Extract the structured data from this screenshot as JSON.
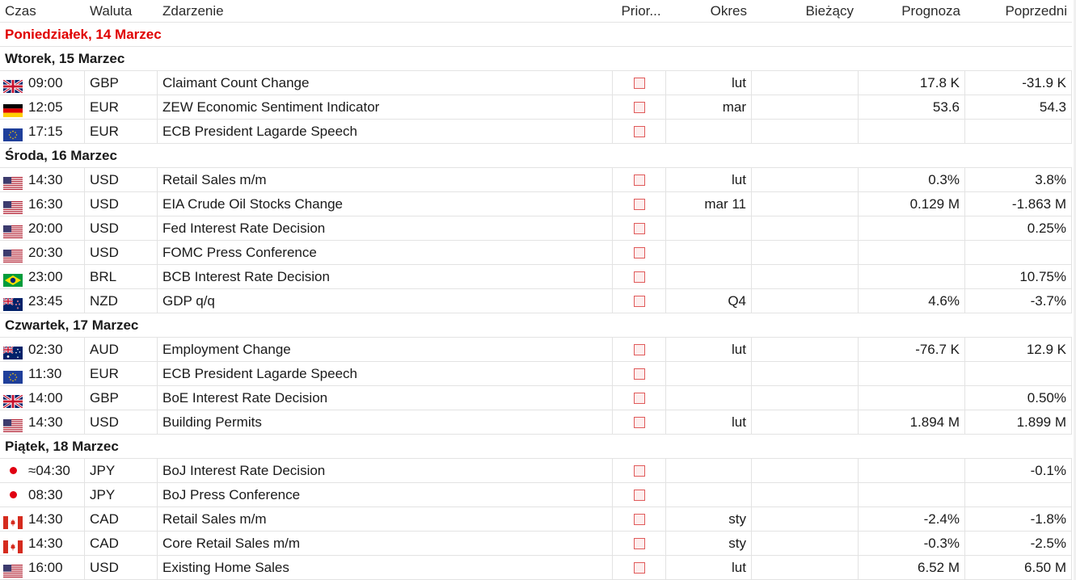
{
  "columns": {
    "time": "Czas",
    "currency": "Waluta",
    "event": "Zdarzenie",
    "priority": "Prior...",
    "period": "Okres",
    "actual": "Bieżący",
    "forecast": "Prognoza",
    "previous": "Poprzedni"
  },
  "colors": {
    "today_day": "#e00000",
    "priority_border": "#e05a5a",
    "priority_fill": "#fdeeee"
  },
  "sections": [
    {
      "day": "Poniedziałek, 14 Marzec",
      "today": true,
      "rows": []
    },
    {
      "day": "Wtorek, 15 Marzec",
      "rows": [
        {
          "flag": "gb-flag",
          "time": "09:00",
          "currency": "GBP",
          "event": "Claimant Count Change",
          "period": "lut",
          "actual": "",
          "forecast": "17.8 K",
          "previous": "-31.9 K"
        },
        {
          "flag": "de-flag",
          "time": "12:05",
          "currency": "EUR",
          "event": "ZEW Economic Sentiment Indicator",
          "period": "mar",
          "actual": "",
          "forecast": "53.6",
          "previous": "54.3"
        },
        {
          "flag": "eu-flag",
          "time": "17:15",
          "currency": "EUR",
          "event": "ECB President Lagarde Speech",
          "period": "",
          "actual": "",
          "forecast": "",
          "previous": ""
        }
      ]
    },
    {
      "day": "Środa, 16 Marzec",
      "rows": [
        {
          "flag": "us-flag",
          "time": "14:30",
          "currency": "USD",
          "event": "Retail Sales m/m",
          "period": "lut",
          "actual": "",
          "forecast": "0.3%",
          "previous": "3.8%"
        },
        {
          "flag": "us-flag",
          "time": "16:30",
          "currency": "USD",
          "event": "EIA Crude Oil Stocks Change",
          "period": "mar 11",
          "actual": "",
          "forecast": "0.129 M",
          "previous": "-1.863 M"
        },
        {
          "flag": "us-flag",
          "time": "20:00",
          "currency": "USD",
          "event": "Fed Interest Rate Decision",
          "period": "",
          "actual": "",
          "forecast": "",
          "previous": "0.25%"
        },
        {
          "flag": "us-flag",
          "time": "20:30",
          "currency": "USD",
          "event": "FOMC Press Conference",
          "period": "",
          "actual": "",
          "forecast": "",
          "previous": ""
        },
        {
          "flag": "br-flag",
          "time": "23:00",
          "currency": "BRL",
          "event": "BCB Interest Rate Decision",
          "period": "",
          "actual": "",
          "forecast": "",
          "previous": "10.75%"
        },
        {
          "flag": "nz-flag",
          "time": "23:45",
          "currency": "NZD",
          "event": "GDP q/q",
          "period": "Q4",
          "actual": "",
          "forecast": "4.6%",
          "previous": "-3.7%"
        }
      ]
    },
    {
      "day": "Czwartek, 17 Marzec",
      "rows": [
        {
          "flag": "au-flag",
          "time": "02:30",
          "currency": "AUD",
          "event": "Employment Change",
          "period": "lut",
          "actual": "",
          "forecast": "-76.7 K",
          "previous": "12.9 K"
        },
        {
          "flag": "eu-flag",
          "time": "11:30",
          "currency": "EUR",
          "event": "ECB President Lagarde Speech",
          "period": "",
          "actual": "",
          "forecast": "",
          "previous": ""
        },
        {
          "flag": "gb-flag",
          "time": "14:00",
          "currency": "GBP",
          "event": "BoE Interest Rate Decision",
          "period": "",
          "actual": "",
          "forecast": "",
          "previous": "0.50%"
        },
        {
          "flag": "us-flag",
          "time": "14:30",
          "currency": "USD",
          "event": "Building Permits",
          "period": "lut",
          "actual": "",
          "forecast": "1.894 M",
          "previous": "1.899 M"
        }
      ]
    },
    {
      "day": "Piątek, 18 Marzec",
      "rows": [
        {
          "flag": "jp-flag",
          "time": "≈04:30",
          "currency": "JPY",
          "event": "BoJ Interest Rate Decision",
          "period": "",
          "actual": "",
          "forecast": "",
          "previous": "-0.1%"
        },
        {
          "flag": "jp-flag",
          "time": "08:30",
          "currency": "JPY",
          "event": "BoJ Press Conference",
          "period": "",
          "actual": "",
          "forecast": "",
          "previous": ""
        },
        {
          "flag": "ca-flag",
          "time": "14:30",
          "currency": "CAD",
          "event": "Retail Sales m/m",
          "period": "sty",
          "actual": "",
          "forecast": "-2.4%",
          "previous": "-1.8%"
        },
        {
          "flag": "ca-flag",
          "time": "14:30",
          "currency": "CAD",
          "event": "Core Retail Sales m/m",
          "period": "sty",
          "actual": "",
          "forecast": "-0.3%",
          "previous": "-2.5%"
        },
        {
          "flag": "us-flag",
          "time": "16:00",
          "currency": "USD",
          "event": "Existing Home Sales",
          "period": "lut",
          "actual": "",
          "forecast": "6.52 M",
          "previous": "6.50 M"
        }
      ]
    }
  ]
}
